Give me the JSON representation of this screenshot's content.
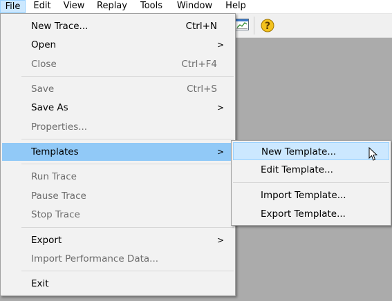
{
  "menubar": {
    "items": [
      "File",
      "Edit",
      "View",
      "Replay",
      "Tools",
      "Window",
      "Help"
    ]
  },
  "toolbar": {
    "icons": [
      "chart-icon",
      "help-icon"
    ]
  },
  "file_menu": {
    "items": [
      {
        "label": "New Trace...",
        "shortcut": "Ctrl+N",
        "enabled": true
      },
      {
        "label": "Open",
        "submenu": true,
        "enabled": true
      },
      {
        "label": "Close",
        "shortcut": "Ctrl+F4",
        "enabled": false
      },
      {
        "label": "Save",
        "shortcut": "Ctrl+S",
        "enabled": false
      },
      {
        "label": "Save As",
        "submenu": true,
        "enabled": true
      },
      {
        "label": "Properties...",
        "enabled": false
      },
      {
        "label": "Templates",
        "submenu": true,
        "enabled": true,
        "highlighted": true
      },
      {
        "label": "Run Trace",
        "enabled": false
      },
      {
        "label": "Pause Trace",
        "enabled": false
      },
      {
        "label": "Stop Trace",
        "enabled": false
      },
      {
        "label": "Export",
        "submenu": true,
        "enabled": true
      },
      {
        "label": "Import Performance Data...",
        "enabled": false
      },
      {
        "label": "Exit",
        "enabled": true
      }
    ]
  },
  "templates_menu": {
    "items": [
      {
        "label": "New Template...",
        "hovered": true
      },
      {
        "label": "Edit Template..."
      },
      {
        "label": "Import Template..."
      },
      {
        "label": "Export Template..."
      }
    ]
  },
  "colors": {
    "workspace": "#ababab",
    "menu_bg": "#f2f2f2",
    "highlight": "#91c9f7",
    "hover": "#cce8ff",
    "disabled_text": "#6d6d6d"
  }
}
